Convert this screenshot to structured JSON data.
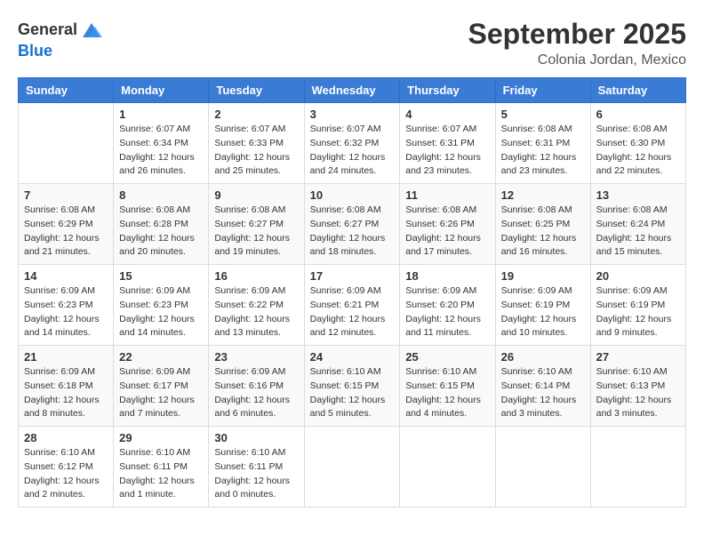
{
  "logo": {
    "general": "General",
    "blue": "Blue"
  },
  "header": {
    "month": "September 2025",
    "location": "Colonia Jordan, Mexico"
  },
  "weekdays": [
    "Sunday",
    "Monday",
    "Tuesday",
    "Wednesday",
    "Thursday",
    "Friday",
    "Saturday"
  ],
  "weeks": [
    [
      {
        "day": "",
        "sunrise": "",
        "sunset": "",
        "daylight": ""
      },
      {
        "day": "1",
        "sunrise": "Sunrise: 6:07 AM",
        "sunset": "Sunset: 6:34 PM",
        "daylight": "Daylight: 12 hours and 26 minutes."
      },
      {
        "day": "2",
        "sunrise": "Sunrise: 6:07 AM",
        "sunset": "Sunset: 6:33 PM",
        "daylight": "Daylight: 12 hours and 25 minutes."
      },
      {
        "day": "3",
        "sunrise": "Sunrise: 6:07 AM",
        "sunset": "Sunset: 6:32 PM",
        "daylight": "Daylight: 12 hours and 24 minutes."
      },
      {
        "day": "4",
        "sunrise": "Sunrise: 6:07 AM",
        "sunset": "Sunset: 6:31 PM",
        "daylight": "Daylight: 12 hours and 23 minutes."
      },
      {
        "day": "5",
        "sunrise": "Sunrise: 6:08 AM",
        "sunset": "Sunset: 6:31 PM",
        "daylight": "Daylight: 12 hours and 23 minutes."
      },
      {
        "day": "6",
        "sunrise": "Sunrise: 6:08 AM",
        "sunset": "Sunset: 6:30 PM",
        "daylight": "Daylight: 12 hours and 22 minutes."
      }
    ],
    [
      {
        "day": "7",
        "sunrise": "Sunrise: 6:08 AM",
        "sunset": "Sunset: 6:29 PM",
        "daylight": "Daylight: 12 hours and 21 minutes."
      },
      {
        "day": "8",
        "sunrise": "Sunrise: 6:08 AM",
        "sunset": "Sunset: 6:28 PM",
        "daylight": "Daylight: 12 hours and 20 minutes."
      },
      {
        "day": "9",
        "sunrise": "Sunrise: 6:08 AM",
        "sunset": "Sunset: 6:27 PM",
        "daylight": "Daylight: 12 hours and 19 minutes."
      },
      {
        "day": "10",
        "sunrise": "Sunrise: 6:08 AM",
        "sunset": "Sunset: 6:27 PM",
        "daylight": "Daylight: 12 hours and 18 minutes."
      },
      {
        "day": "11",
        "sunrise": "Sunrise: 6:08 AM",
        "sunset": "Sunset: 6:26 PM",
        "daylight": "Daylight: 12 hours and 17 minutes."
      },
      {
        "day": "12",
        "sunrise": "Sunrise: 6:08 AM",
        "sunset": "Sunset: 6:25 PM",
        "daylight": "Daylight: 12 hours and 16 minutes."
      },
      {
        "day": "13",
        "sunrise": "Sunrise: 6:08 AM",
        "sunset": "Sunset: 6:24 PM",
        "daylight": "Daylight: 12 hours and 15 minutes."
      }
    ],
    [
      {
        "day": "14",
        "sunrise": "Sunrise: 6:09 AM",
        "sunset": "Sunset: 6:23 PM",
        "daylight": "Daylight: 12 hours and 14 minutes."
      },
      {
        "day": "15",
        "sunrise": "Sunrise: 6:09 AM",
        "sunset": "Sunset: 6:23 PM",
        "daylight": "Daylight: 12 hours and 14 minutes."
      },
      {
        "day": "16",
        "sunrise": "Sunrise: 6:09 AM",
        "sunset": "Sunset: 6:22 PM",
        "daylight": "Daylight: 12 hours and 13 minutes."
      },
      {
        "day": "17",
        "sunrise": "Sunrise: 6:09 AM",
        "sunset": "Sunset: 6:21 PM",
        "daylight": "Daylight: 12 hours and 12 minutes."
      },
      {
        "day": "18",
        "sunrise": "Sunrise: 6:09 AM",
        "sunset": "Sunset: 6:20 PM",
        "daylight": "Daylight: 12 hours and 11 minutes."
      },
      {
        "day": "19",
        "sunrise": "Sunrise: 6:09 AM",
        "sunset": "Sunset: 6:19 PM",
        "daylight": "Daylight: 12 hours and 10 minutes."
      },
      {
        "day": "20",
        "sunrise": "Sunrise: 6:09 AM",
        "sunset": "Sunset: 6:19 PM",
        "daylight": "Daylight: 12 hours and 9 minutes."
      }
    ],
    [
      {
        "day": "21",
        "sunrise": "Sunrise: 6:09 AM",
        "sunset": "Sunset: 6:18 PM",
        "daylight": "Daylight: 12 hours and 8 minutes."
      },
      {
        "day": "22",
        "sunrise": "Sunrise: 6:09 AM",
        "sunset": "Sunset: 6:17 PM",
        "daylight": "Daylight: 12 hours and 7 minutes."
      },
      {
        "day": "23",
        "sunrise": "Sunrise: 6:09 AM",
        "sunset": "Sunset: 6:16 PM",
        "daylight": "Daylight: 12 hours and 6 minutes."
      },
      {
        "day": "24",
        "sunrise": "Sunrise: 6:10 AM",
        "sunset": "Sunset: 6:15 PM",
        "daylight": "Daylight: 12 hours and 5 minutes."
      },
      {
        "day": "25",
        "sunrise": "Sunrise: 6:10 AM",
        "sunset": "Sunset: 6:15 PM",
        "daylight": "Daylight: 12 hours and 4 minutes."
      },
      {
        "day": "26",
        "sunrise": "Sunrise: 6:10 AM",
        "sunset": "Sunset: 6:14 PM",
        "daylight": "Daylight: 12 hours and 3 minutes."
      },
      {
        "day": "27",
        "sunrise": "Sunrise: 6:10 AM",
        "sunset": "Sunset: 6:13 PM",
        "daylight": "Daylight: 12 hours and 3 minutes."
      }
    ],
    [
      {
        "day": "28",
        "sunrise": "Sunrise: 6:10 AM",
        "sunset": "Sunset: 6:12 PM",
        "daylight": "Daylight: 12 hours and 2 minutes."
      },
      {
        "day": "29",
        "sunrise": "Sunrise: 6:10 AM",
        "sunset": "Sunset: 6:11 PM",
        "daylight": "Daylight: 12 hours and 1 minute."
      },
      {
        "day": "30",
        "sunrise": "Sunrise: 6:10 AM",
        "sunset": "Sunset: 6:11 PM",
        "daylight": "Daylight: 12 hours and 0 minutes."
      },
      {
        "day": "",
        "sunrise": "",
        "sunset": "",
        "daylight": ""
      },
      {
        "day": "",
        "sunrise": "",
        "sunset": "",
        "daylight": ""
      },
      {
        "day": "",
        "sunrise": "",
        "sunset": "",
        "daylight": ""
      },
      {
        "day": "",
        "sunrise": "",
        "sunset": "",
        "daylight": ""
      }
    ]
  ]
}
